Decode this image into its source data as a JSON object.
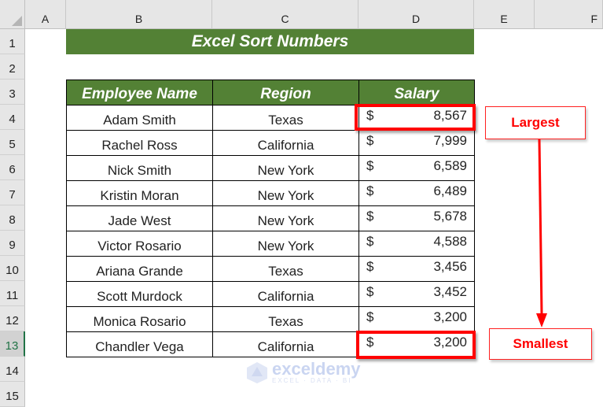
{
  "columns": [
    "A",
    "B",
    "C",
    "D",
    "E",
    "F"
  ],
  "rows": [
    "1",
    "2",
    "3",
    "4",
    "5",
    "6",
    "7",
    "8",
    "9",
    "10",
    "11",
    "12",
    "13",
    "14",
    "15"
  ],
  "selected_row": "13",
  "sheet": {
    "title": "Excel Sort Numbers",
    "headers": {
      "name": "Employee Name",
      "region": "Region",
      "salary": "Salary"
    },
    "records": [
      {
        "name": "Adam Smith",
        "region": "Texas",
        "currency": "$",
        "salary": "8,567"
      },
      {
        "name": "Rachel Ross",
        "region": "California",
        "currency": "$",
        "salary": "7,999"
      },
      {
        "name": "Nick Smith",
        "region": "New York",
        "currency": "$",
        "salary": "6,589"
      },
      {
        "name": "Kristin Moran",
        "region": "New York",
        "currency": "$",
        "salary": "6,489"
      },
      {
        "name": "Jade West",
        "region": "New York",
        "currency": "$",
        "salary": "5,678"
      },
      {
        "name": "Victor Rosario",
        "region": "New York",
        "currency": "$",
        "salary": "4,588"
      },
      {
        "name": "Ariana Grande",
        "region": "Texas",
        "currency": "$",
        "salary": "3,456"
      },
      {
        "name": "Scott Murdock",
        "region": "California",
        "currency": "$",
        "salary": "3,452"
      },
      {
        "name": "Monica Rosario",
        "region": "Texas",
        "currency": "$",
        "salary": "3,200"
      },
      {
        "name": "Chandler Vega",
        "region": "California",
        "currency": "$",
        "salary": "3,200"
      }
    ]
  },
  "annotations": {
    "largest": "Largest",
    "smallest": "Smallest"
  },
  "watermark": {
    "brand": "exceldemy",
    "tagline": "EXCEL · DATA · BI"
  },
  "colors": {
    "header_green": "#538135",
    "highlight_red": "#ff0000"
  }
}
